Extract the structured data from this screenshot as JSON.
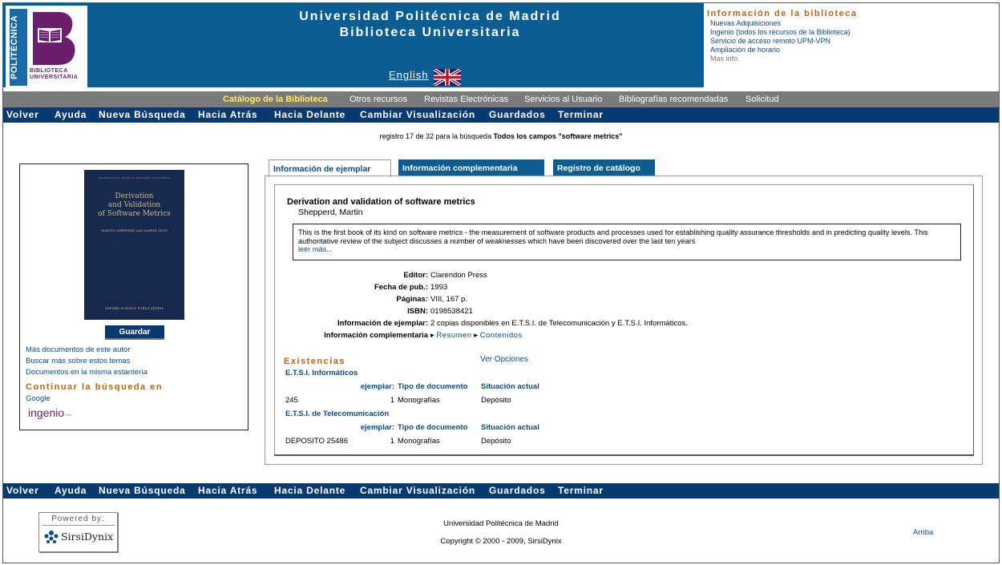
{
  "header": {
    "logo_side_text": "POLITÉCNICA",
    "logo_text_line1": "BIBLIOTECA",
    "logo_text_line2": "UNIVERSITARIA",
    "title_line1": "Universidad Politécnica de Madrid",
    "title_line2": "Biblioteca Universitaria",
    "language_link": "English",
    "flag_icon": "uk-flag-icon"
  },
  "info_panel": {
    "heading": "Información de la biblioteca",
    "links": [
      "Nuevas Adquisiciones",
      "Ingenio (todos los recursos de la Biblioteca)",
      "Servicio de acceso remoto UPM-VPN",
      "Ampliación de horario"
    ],
    "more": "Mas info."
  },
  "subnav": [
    "Catálogo de la Biblioteca",
    "Otros recursos",
    "Revistas Electrónicas",
    "Servicios al Usuario",
    "Bibliografías recomendadas",
    "Solicitud"
  ],
  "mainnav": [
    "Volver",
    "Ayuda",
    "Nueva Búsqueda",
    "Hacia Atrás",
    "Hacia Delante",
    "Cambiar Visualización",
    "Guardados",
    "Terminar"
  ],
  "record_info": {
    "prefix": "registro 17 de 32 para la búsqueda",
    "query": "Todos los campos \"software metrics\""
  },
  "cover": {
    "top_line": "INTERNATIONAL SERIES OF SOFTWARE ENGINEERING",
    "title_line1": "Derivation",
    "title_line2": "and Validation",
    "title_line3": "of Software Metrics",
    "authors": "MARTIN SHEPPERD and DARREL INCE",
    "publisher": "OXFORD SCIENCE PUBLICATIONS"
  },
  "left": {
    "save_button": "Guardar",
    "links": [
      "Más documentos de este autor",
      "Buscar más sobre estos temas",
      "Documentos en la misma estantería"
    ],
    "continue_heading": "Continuar la búsqueda en",
    "google": "Google",
    "ingenio": "ingenio"
  },
  "tabs": [
    "Información de ejemplar",
    "Información complementaria",
    "Registro de catálogo"
  ],
  "record": {
    "title": "Derivation and validation of software metrics",
    "author": "Shepperd, Martin",
    "summary": "This is the first book of its kind on software metrics - the measurement of software products and processes used for establishing quality assurance thresholds and in predicting quality levels. This authoritative review of the subject discusses a number of weaknesses which have been discovered over the last ten years",
    "read_more": "leer más...",
    "fields": [
      {
        "label": "Editor:",
        "value": "Clarendon Press"
      },
      {
        "label": "Fecha de pub.:",
        "value": "1993"
      },
      {
        "label": "Páginas:",
        "value": "VIII, 167 p."
      },
      {
        "label": "ISBN:",
        "value": "0198538421"
      },
      {
        "label": "Información de ejemplar:",
        "value": "2 copias disponibles en E.T.S.I. de Telecomunicación y E.T.S.I. Informáticos."
      }
    ],
    "complementary_label": "Información complementaria",
    "complementary_links": [
      "Resumen",
      "Contenidos"
    ]
  },
  "holdings": {
    "heading": "Existencias",
    "options_link": "Ver Opciones",
    "columns": [
      "ejemplar:",
      "Tipo de documento",
      "Situación actual"
    ],
    "locations": [
      {
        "name": "E.T.S.I. Informáticos",
        "rows": [
          {
            "signatura": "245",
            "copy": "1",
            "type": "Monografías",
            "status": "Depósito"
          }
        ]
      },
      {
        "name": "E.T.S.I. de Telecomunicación",
        "rows": [
          {
            "signatura": "DEPOSITO 25486",
            "copy": "1",
            "type": "Monografías",
            "status": "Depósito"
          }
        ]
      }
    ]
  },
  "footer": {
    "powered_by": "Powered by:",
    "vendor": "SirsiDynix",
    "university": "Universidad Politécnica de Madrid",
    "copyright": "Copyright © 2000 - 2009, SirsiDynix",
    "top_link": "Arriba"
  }
}
